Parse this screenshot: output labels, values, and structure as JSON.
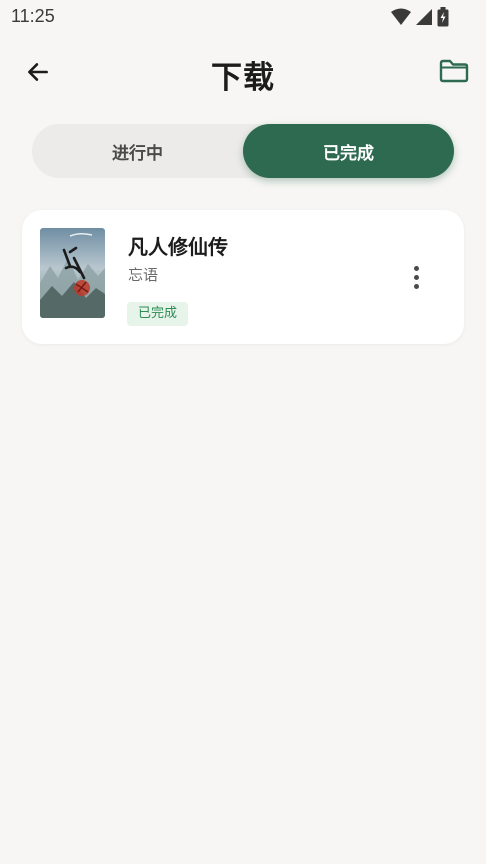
{
  "status_bar": {
    "time": "11:25"
  },
  "header": {
    "title": "下载"
  },
  "tabs": [
    {
      "label": "进行中",
      "active": false
    },
    {
      "label": "已完成",
      "active": true
    }
  ],
  "books": [
    {
      "title": "凡人修仙传",
      "author": "忘语",
      "status": "已完成"
    }
  ],
  "colors": {
    "accent": "#2d6a4f",
    "badge_bg": "#e6f4ea",
    "badge_text": "#2f8a55",
    "background": "#f7f6f4"
  }
}
